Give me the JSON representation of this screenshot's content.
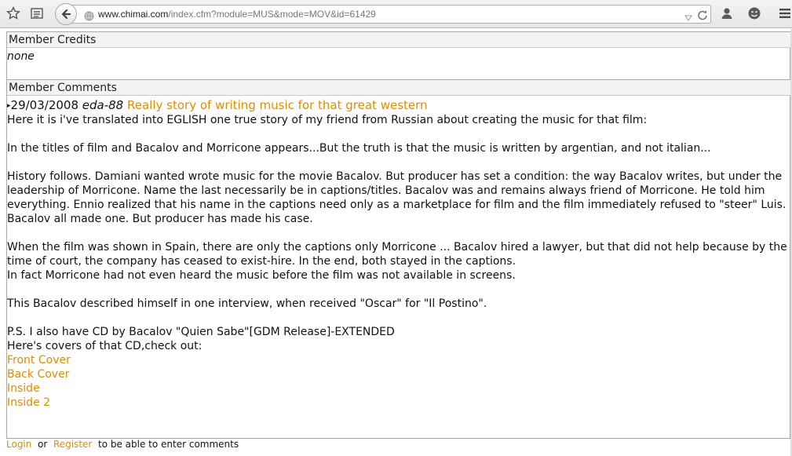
{
  "browser": {
    "url_domain": "www.chimai.com",
    "url_path": "/index.cfm?module=MUS&mode=MOV&id=61429",
    "icons": [
      "star-icon",
      "reading-list-icon",
      "back-arrow-icon",
      "globe-icon",
      "dropdown-arrow-icon",
      "reload-icon",
      "user-icon",
      "smiley-icon",
      "menu-icon"
    ]
  },
  "credits": {
    "heading": "Member Credits",
    "value": "none"
  },
  "comments": {
    "heading": "Member Comments",
    "items": [
      {
        "bullet": "▸",
        "date": "29/03/2008",
        "author": "eda-88",
        "title": "Really story of writing music for that great western",
        "paragraphs": [
          "Here it is i've translated into EGLISH one true story of my friend from Russian about creating the music for that film:",
          "In the titles of film and Bacalov and Morricone appears...But the truth is that the music is written by argentian, and not italian...",
          "History follows. Damiani wanted wrote music for the movie Bacalov. But producer has set a condition: the way Bacalov writes, but under the leadership of Morricone. Name the last necessarily be in captions/titles. Bacalov was and remains always friend of Morricone. He told him everything. Ennio realized that his name in the captions need only as a marketplace for film and the film immediately refused to \"steer\" Luis. Bacalov all made one. But producer has made his case.",
          "When the film was shown in Spain, there are only the captions only Morricone ... Bacalov hired a lawyer, but that did not help because by the time of court, the company has ceased to exist-hire. In the end, both stayed in the captions.",
          "In fact Morricone had not even heard the music before the film was not available in screens.",
          "This Bacalov described himself in one interview, when received \"Oscar\" for \"Il Postino\".",
          "P.S. I also have CD by Bacalov \"Quien Sabe\"[GDM Release]-EXTENDED",
          "Here's covers of that CD,check out:"
        ],
        "links": [
          "Front Cover",
          "Back Cover",
          "Inside",
          "Inside 2"
        ]
      }
    ]
  },
  "footer": {
    "login": "Login",
    "or": "or",
    "register": "Register",
    "suffix": "to be able to enter comments"
  },
  "colors": {
    "link": "#e28a00",
    "border": "#a9a9a9",
    "header_bg": "#f3f3f3"
  }
}
